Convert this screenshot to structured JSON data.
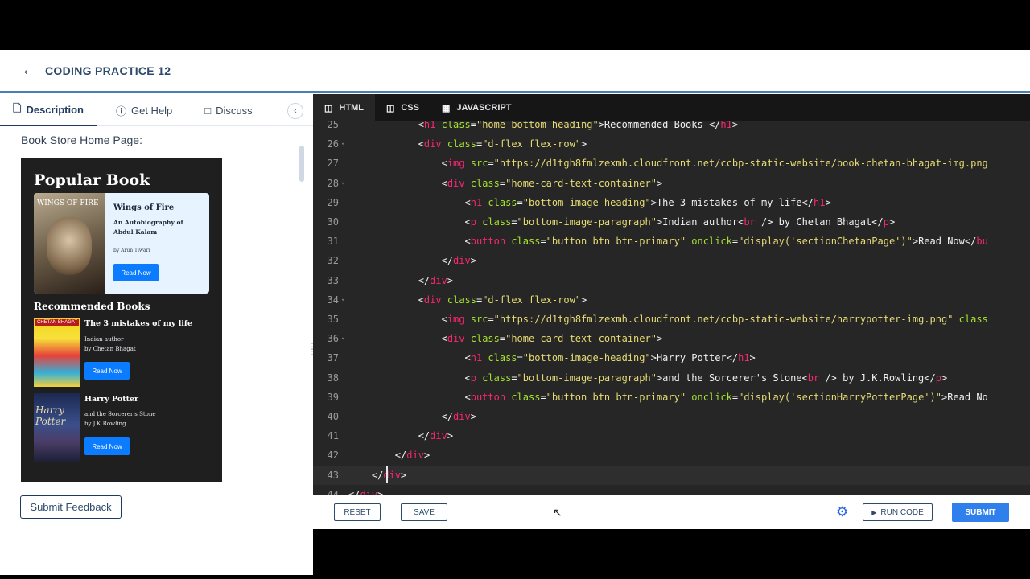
{
  "header": {
    "back_icon": "arrow-left-icon",
    "title": "CODING PRACTICE 12"
  },
  "left_tabs": [
    {
      "label": "Description",
      "icon": "document-icon",
      "active": true
    },
    {
      "label": "Get Help",
      "icon": "help-circle-icon",
      "active": false
    },
    {
      "label": "Discuss",
      "icon": "chat-icon",
      "active": false
    }
  ],
  "description": {
    "heading": "Book Store Home Page:"
  },
  "preview": {
    "popular_title": "Popular Book",
    "popular_cover_text": "WINGS OF FIRE",
    "popular_heading": "Wings of Fire",
    "popular_subtitle": "An Autobiography of Abdul Kalam",
    "popular_author": "by Arun Tiwari",
    "popular_button": "Read Now",
    "recommended_title": "Recommended Books",
    "books": [
      {
        "cover_text": "CHETAN BHAGAT",
        "heading": "The 3 mistakes of my life",
        "line1": "Indian author",
        "line2": "by Chetan Bhagat",
        "button": "Read Now"
      },
      {
        "cover_text": "Harry Potter",
        "heading": "Harry Potter",
        "line1": "and the Sorcerer's Stone",
        "line2": "by J.K.Rowling",
        "button": "Read Now"
      }
    ]
  },
  "feedback_button": "Submit Feedback",
  "editor_tabs": [
    {
      "label": "HTML",
      "icon": "html5-icon",
      "active": true
    },
    {
      "label": "CSS",
      "icon": "css3-icon",
      "active": false
    },
    {
      "label": "JAVASCRIPT",
      "icon": "js-file-icon",
      "active": false
    }
  ],
  "code_lines": [
    {
      "n": "25",
      "fold": false,
      "parts": [
        [
          "p",
          "            <"
        ],
        [
          "t",
          "h1"
        ],
        [
          "p",
          " "
        ],
        [
          "a",
          "class"
        ],
        [
          "p",
          "="
        ],
        [
          "s",
          "\"home-bottom-heading\""
        ],
        [
          "p",
          ">Recommended Books </"
        ],
        [
          "t",
          "h1"
        ],
        [
          "p",
          ">"
        ]
      ]
    },
    {
      "n": "26",
      "fold": true,
      "parts": [
        [
          "p",
          "            <"
        ],
        [
          "t",
          "div"
        ],
        [
          "p",
          " "
        ],
        [
          "a",
          "class"
        ],
        [
          "p",
          "="
        ],
        [
          "s",
          "\"d-flex flex-row\""
        ],
        [
          "p",
          ">"
        ]
      ]
    },
    {
      "n": "27",
      "fold": false,
      "parts": [
        [
          "p",
          "                <"
        ],
        [
          "t",
          "img"
        ],
        [
          "p",
          " "
        ],
        [
          "a",
          "src"
        ],
        [
          "p",
          "="
        ],
        [
          "s",
          "\"https://d1tgh8fmlzexmh.cloudfront.net/ccbp-static-website/book-chetan-bhagat-img.png"
        ]
      ]
    },
    {
      "n": "28",
      "fold": true,
      "parts": [
        [
          "p",
          "                <"
        ],
        [
          "t",
          "div"
        ],
        [
          "p",
          " "
        ],
        [
          "a",
          "class"
        ],
        [
          "p",
          "="
        ],
        [
          "s",
          "\"home-card-text-container\""
        ],
        [
          "p",
          ">"
        ]
      ]
    },
    {
      "n": "29",
      "fold": false,
      "parts": [
        [
          "p",
          "                    <"
        ],
        [
          "t",
          "h1"
        ],
        [
          "p",
          " "
        ],
        [
          "a",
          "class"
        ],
        [
          "p",
          "="
        ],
        [
          "s",
          "\"bottom-image-heading\""
        ],
        [
          "p",
          ">The 3 mistakes of my life</"
        ],
        [
          "t",
          "h1"
        ],
        [
          "p",
          ">"
        ]
      ]
    },
    {
      "n": "30",
      "fold": false,
      "parts": [
        [
          "p",
          "                    <"
        ],
        [
          "t",
          "p"
        ],
        [
          "p",
          " "
        ],
        [
          "a",
          "class"
        ],
        [
          "p",
          "="
        ],
        [
          "s",
          "\"bottom-image-paragraph\""
        ],
        [
          "p",
          ">Indian author<"
        ],
        [
          "t",
          "br"
        ],
        [
          "p",
          " /> by Chetan Bhagat</"
        ],
        [
          "t",
          "p"
        ],
        [
          "p",
          ">"
        ]
      ]
    },
    {
      "n": "31",
      "fold": false,
      "parts": [
        [
          "p",
          "                    <"
        ],
        [
          "t",
          "button"
        ],
        [
          "p",
          " "
        ],
        [
          "a",
          "class"
        ],
        [
          "p",
          "="
        ],
        [
          "s",
          "\"button btn btn-primary\""
        ],
        [
          "p",
          " "
        ],
        [
          "a",
          "onclick"
        ],
        [
          "p",
          "="
        ],
        [
          "s",
          "\"display('sectionChetanPage')\""
        ],
        [
          "p",
          ">Read Now</"
        ],
        [
          "t",
          "bu"
        ]
      ]
    },
    {
      "n": "32",
      "fold": false,
      "parts": [
        [
          "p",
          "                </"
        ],
        [
          "t",
          "div"
        ],
        [
          "p",
          ">"
        ]
      ]
    },
    {
      "n": "33",
      "fold": false,
      "parts": [
        [
          "p",
          "            </"
        ],
        [
          "t",
          "div"
        ],
        [
          "p",
          ">"
        ]
      ]
    },
    {
      "n": "34",
      "fold": true,
      "parts": [
        [
          "p",
          "            <"
        ],
        [
          "t",
          "div"
        ],
        [
          "p",
          " "
        ],
        [
          "a",
          "class"
        ],
        [
          "p",
          "="
        ],
        [
          "s",
          "\"d-flex flex-row\""
        ],
        [
          "p",
          ">"
        ]
      ]
    },
    {
      "n": "35",
      "fold": false,
      "parts": [
        [
          "p",
          "                <"
        ],
        [
          "t",
          "img"
        ],
        [
          "p",
          " "
        ],
        [
          "a",
          "src"
        ],
        [
          "p",
          "="
        ],
        [
          "s",
          "\"https://d1tgh8fmlzexmh.cloudfront.net/ccbp-static-website/harrypotter-img.png\""
        ],
        [
          "p",
          " "
        ],
        [
          "a",
          "class"
        ]
      ]
    },
    {
      "n": "36",
      "fold": true,
      "parts": [
        [
          "p",
          "                <"
        ],
        [
          "t",
          "div"
        ],
        [
          "p",
          " "
        ],
        [
          "a",
          "class"
        ],
        [
          "p",
          "="
        ],
        [
          "s",
          "\"home-card-text-container\""
        ],
        [
          "p",
          ">"
        ]
      ]
    },
    {
      "n": "37",
      "fold": false,
      "parts": [
        [
          "p",
          "                    <"
        ],
        [
          "t",
          "h1"
        ],
        [
          "p",
          " "
        ],
        [
          "a",
          "class"
        ],
        [
          "p",
          "="
        ],
        [
          "s",
          "\"bottom-image-heading\""
        ],
        [
          "p",
          ">Harry Potter</"
        ],
        [
          "t",
          "h1"
        ],
        [
          "p",
          ">"
        ]
      ]
    },
    {
      "n": "38",
      "fold": false,
      "parts": [
        [
          "p",
          "                    <"
        ],
        [
          "t",
          "p"
        ],
        [
          "p",
          " "
        ],
        [
          "a",
          "class"
        ],
        [
          "p",
          "="
        ],
        [
          "s",
          "\"bottom-image-paragraph\""
        ],
        [
          "p",
          ">and the Sorcerer's Stone<"
        ],
        [
          "t",
          "br"
        ],
        [
          "p",
          " /> by J.K.Rowling</"
        ],
        [
          "t",
          "p"
        ],
        [
          "p",
          ">"
        ]
      ]
    },
    {
      "n": "39",
      "fold": false,
      "parts": [
        [
          "p",
          "                    <"
        ],
        [
          "t",
          "button"
        ],
        [
          "p",
          " "
        ],
        [
          "a",
          "class"
        ],
        [
          "p",
          "="
        ],
        [
          "s",
          "\"button btn btn-primary\""
        ],
        [
          "p",
          " "
        ],
        [
          "a",
          "onclick"
        ],
        [
          "p",
          "="
        ],
        [
          "s",
          "\"display('sectionHarryPotterPage')\""
        ],
        [
          "p",
          ">Read No"
        ]
      ]
    },
    {
      "n": "40",
      "fold": false,
      "parts": [
        [
          "p",
          "                </"
        ],
        [
          "t",
          "div"
        ],
        [
          "p",
          ">"
        ]
      ]
    },
    {
      "n": "41",
      "fold": false,
      "parts": [
        [
          "p",
          "            </"
        ],
        [
          "t",
          "div"
        ],
        [
          "p",
          ">"
        ]
      ]
    },
    {
      "n": "42",
      "fold": false,
      "parts": [
        [
          "p",
          "        </"
        ],
        [
          "t",
          "div"
        ],
        [
          "p",
          ">"
        ]
      ]
    },
    {
      "n": "43",
      "fold": false,
      "parts": [
        [
          "p",
          "    </"
        ],
        [
          "t",
          "div"
        ],
        [
          "p",
          ">"
        ]
      ]
    },
    {
      "n": "44",
      "fold": false,
      "parts": [
        [
          "p",
          "</"
        ],
        [
          "t",
          "div"
        ],
        [
          "p",
          ">"
        ]
      ]
    }
  ],
  "footer": {
    "reset": "RESET",
    "save": "SAVE",
    "settings_icon": "gear-icon",
    "run": "RUN CODE",
    "run_icon": "play-icon",
    "submit": "SUBMIT"
  }
}
